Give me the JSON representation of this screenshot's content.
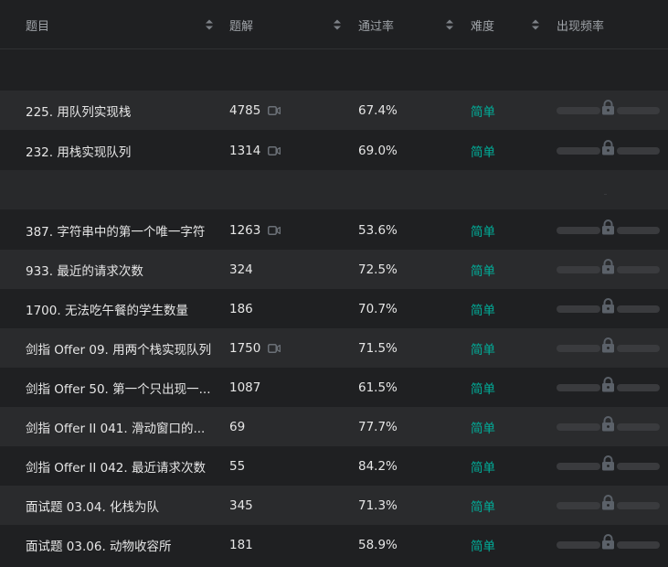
{
  "header": {
    "title": "题目",
    "solutions": "题解",
    "rate": "通过率",
    "difficulty": "难度",
    "frequency": "出现频率"
  },
  "rows": [
    {
      "title": "225. 用队列实现栈",
      "solutions": "4785",
      "video": true,
      "rate": "67.4%",
      "difficulty": "简单"
    },
    {
      "title": "232. 用栈实现队列",
      "solutions": "1314",
      "video": true,
      "rate": "69.0%",
      "difficulty": "简单"
    },
    {
      "title": "387. 字符串中的第一个唯一字符",
      "solutions": "1263",
      "video": true,
      "rate": "53.6%",
      "difficulty": "简单"
    },
    {
      "title": "933. 最近的请求次数",
      "solutions": "324",
      "video": false,
      "rate": "72.5%",
      "difficulty": "简单"
    },
    {
      "title": "1700. 无法吃午餐的学生数量",
      "solutions": "186",
      "video": false,
      "rate": "70.7%",
      "difficulty": "简单"
    },
    {
      "title": "剑指 Offer 09. 用两个栈实现队列",
      "solutions": "1750",
      "video": true,
      "rate": "71.5%",
      "difficulty": "简单"
    },
    {
      "title": "剑指 Offer 50. 第一个只出现一...",
      "solutions": "1087",
      "video": false,
      "rate": "61.5%",
      "difficulty": "简单"
    },
    {
      "title": "剑指 Offer II 041. 滑动窗口的...",
      "solutions": "69",
      "video": false,
      "rate": "77.7%",
      "difficulty": "简单"
    },
    {
      "title": "剑指 Offer II 042. 最近请求次数",
      "solutions": "55",
      "video": false,
      "rate": "84.2%",
      "difficulty": "简单"
    },
    {
      "title": "面试题 03.04. 化栈为队",
      "solutions": "345",
      "video": false,
      "rate": "71.3%",
      "difficulty": "简单"
    },
    {
      "title": "面试题 03.06. 动物收容所",
      "solutions": "181",
      "video": false,
      "rate": "58.9%",
      "difficulty": "简单"
    }
  ],
  "colors": {
    "background": "#1f2022",
    "row_alt": "#2a2b2d",
    "header_text": "#9fa3a8",
    "easy": "#00af9b",
    "bar": "#3a3b3e",
    "lock": "#5b6169"
  }
}
